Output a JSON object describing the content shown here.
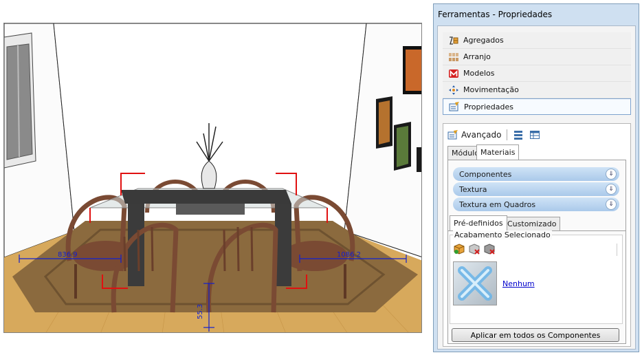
{
  "window": {
    "title": "Ferramentas - Propriedades"
  },
  "nav": {
    "items": [
      {
        "label": "Agregados",
        "icon": "aggregates-icon"
      },
      {
        "label": "Arranjo",
        "icon": "arrangement-icon"
      },
      {
        "label": "Modelos",
        "icon": "models-icon"
      },
      {
        "label": "Movimentação",
        "icon": "move-icon"
      },
      {
        "label": "Propriedades",
        "icon": "properties-icon",
        "selected": true
      }
    ]
  },
  "properties": {
    "header_label": "Avançado",
    "tabs": [
      "Módulo",
      "Materiais"
    ],
    "active_tab": "Materiais",
    "accordions": [
      "Componentes",
      "Textura",
      "Textura em Quadros"
    ],
    "subtabs": [
      "Pré-definidos",
      "Customizado"
    ],
    "active_subtab": "Pré-definidos",
    "group_title": "Acabamento Selecionado",
    "selected_finish": "Nenhum",
    "apply_button": "Aplicar em todos os Componentes"
  },
  "scene": {
    "dimension_labels": [
      "836.9",
      "1086.2",
      "55.3"
    ]
  },
  "colors": {
    "panel_bg": "#cfe0f1",
    "accordion": "#aac9ea",
    "selected_border": "#7da2ce",
    "dimension_red": "#e01010",
    "dimension_blue": "#1020d0",
    "floor": "#d7a95c",
    "rug": "#8b6a3e",
    "chair": "#7a4a33"
  }
}
